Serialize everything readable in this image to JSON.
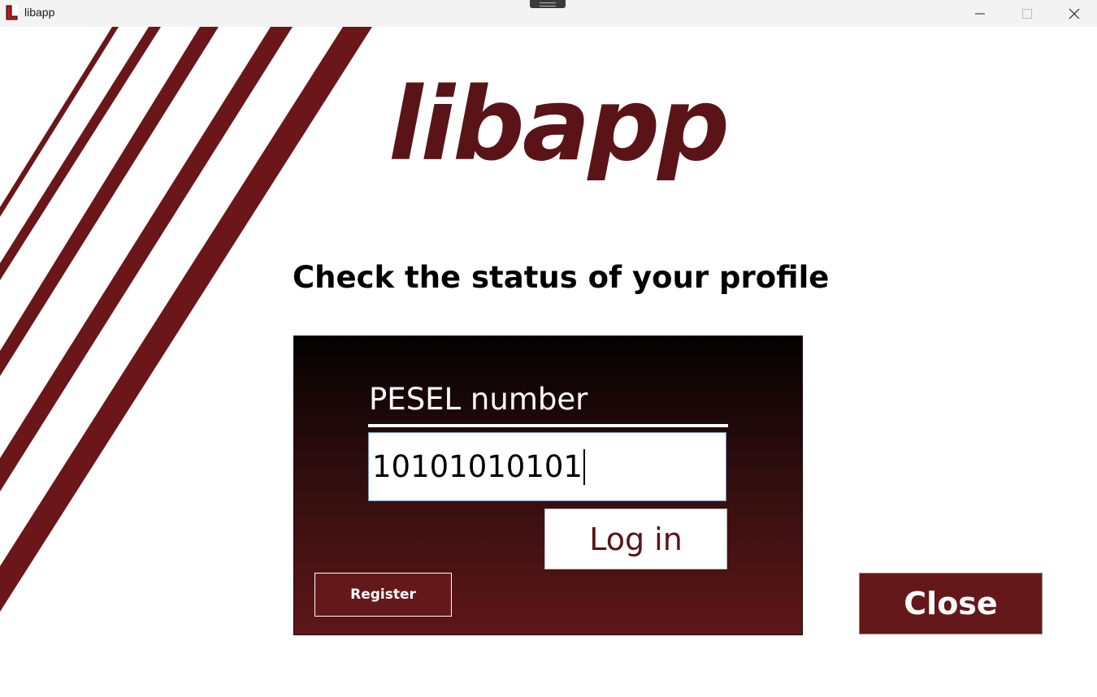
{
  "window": {
    "title": "libapp",
    "app_icon_letter": "L",
    "controls": [
      "minimize-icon",
      "maximize-icon",
      "close-icon"
    ]
  },
  "logo": "libapp",
  "heading": "Check the status of your profile",
  "login_panel": {
    "field_label": "PESEL number",
    "field_value": "10101010101",
    "login_label": "Log in",
    "register_label": "Register"
  },
  "close_label": "Close",
  "colors": {
    "brand": "#651819",
    "logo": "#5a1418",
    "stripe": "#6b1619"
  }
}
